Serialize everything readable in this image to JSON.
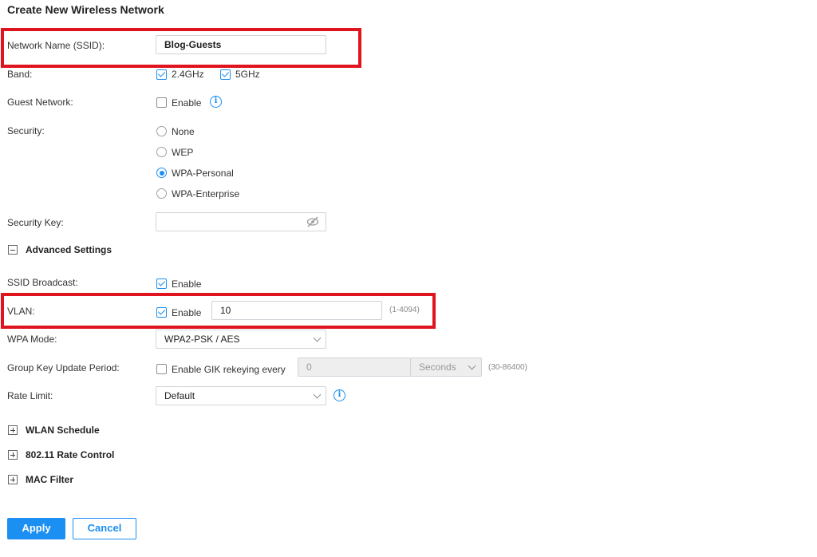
{
  "page": {
    "title": "Create New Wireless Network"
  },
  "ssid": {
    "label": "Network Name (SSID):",
    "value": "Blog-Guests"
  },
  "band": {
    "label": "Band:",
    "option1": "2.4GHz",
    "option2": "5GHz",
    "option1_checked": true,
    "option2_checked": true
  },
  "guest": {
    "label": "Guest Network:",
    "option": "Enable",
    "checked": false
  },
  "security": {
    "label": "Security:",
    "options": [
      "None",
      "WEP",
      "WPA-Personal",
      "WPA-Enterprise"
    ],
    "selected": "WPA-Personal"
  },
  "security_key": {
    "label": "Security Key:",
    "value": ""
  },
  "advanced": {
    "label": "Advanced Settings",
    "expanded": true
  },
  "ssid_broadcast": {
    "label": "SSID Broadcast:",
    "option": "Enable",
    "checked": true
  },
  "vlan": {
    "label": "VLAN:",
    "option": "Enable",
    "checked": true,
    "value": "10",
    "range": "(1-4094)"
  },
  "wpa_mode": {
    "label": "WPA Mode:",
    "value": "WPA2-PSK / AES"
  },
  "gik": {
    "label": "Group Key Update Period:",
    "option": "Enable GIK rekeying every",
    "checked": false,
    "value": "0",
    "unit": "Seconds",
    "range": "(30-86400)"
  },
  "rate_limit": {
    "label": "Rate Limit:",
    "value": "Default"
  },
  "collapsed_sections": {
    "wlan_schedule": "WLAN Schedule",
    "rate_control": "802.11 Rate Control",
    "mac_filter": "MAC Filter"
  },
  "buttons": {
    "apply": "Apply",
    "cancel": "Cancel"
  },
  "colors": {
    "accent": "#1b8ff2",
    "highlight": "#e0141e"
  }
}
